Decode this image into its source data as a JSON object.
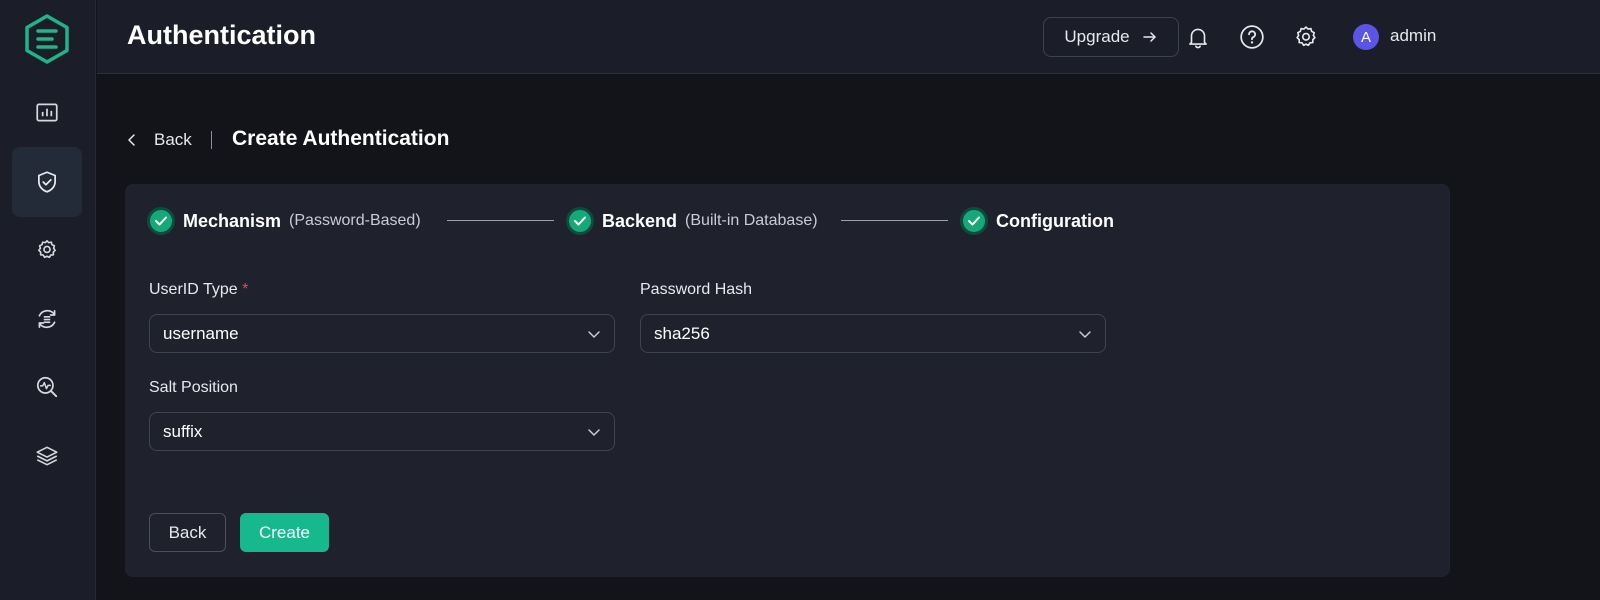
{
  "header": {
    "title": "Authentication",
    "upgrade_label": "Upgrade",
    "user": {
      "avatar_initial": "A",
      "name": "admin"
    }
  },
  "sidebar": {
    "items": [
      {
        "icon": "dashboard-icon",
        "active": false
      },
      {
        "icon": "shield-check-icon",
        "active": true
      },
      {
        "icon": "gear-cog-icon",
        "active": false
      },
      {
        "icon": "integration-icon",
        "active": false
      },
      {
        "icon": "diagnose-icon",
        "active": false
      },
      {
        "icon": "layers-icon",
        "active": false
      }
    ]
  },
  "page": {
    "back_label": "Back",
    "title": "Create Authentication"
  },
  "steps": [
    {
      "title": "Mechanism",
      "sub": "(Password-Based)",
      "status": "complete"
    },
    {
      "title": "Backend",
      "sub": "(Built-in Database)",
      "status": "complete"
    },
    {
      "title": "Configuration",
      "sub": "",
      "status": "complete"
    }
  ],
  "form": {
    "userid_type": {
      "label": "UserID Type",
      "required_mark": "*",
      "value": "username"
    },
    "password_hash": {
      "label": "Password Hash",
      "value": "sha256"
    },
    "salt_position": {
      "label": "Salt Position",
      "value": "suffix"
    }
  },
  "actions": {
    "back_label": "Back",
    "create_label": "Create"
  },
  "colors": {
    "accent": "#16b98d",
    "avatar": "#5b55e6",
    "required": "#e5484d",
    "background": "#131419",
    "panel": "#1f222d"
  }
}
